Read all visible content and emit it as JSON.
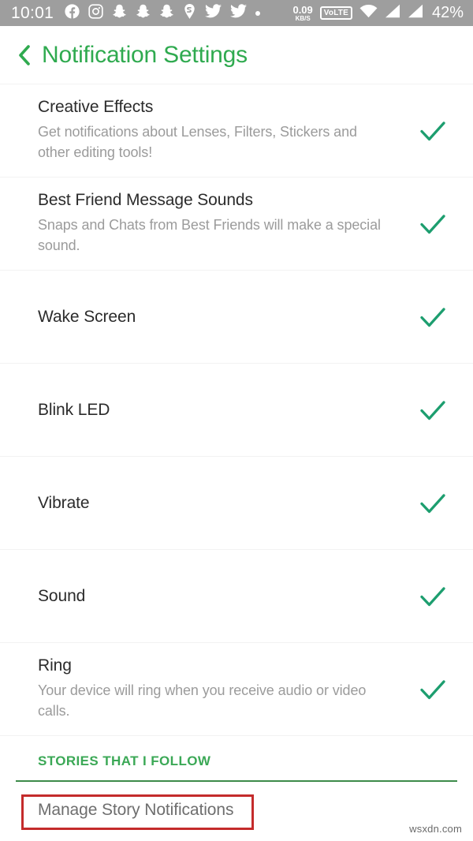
{
  "statusbar": {
    "time": "10:01",
    "app_icons": [
      "facebook-icon",
      "instagram-icon",
      "snapchat-ghost-icon",
      "snapchat-ghost-icon",
      "snapchat-ghost-icon",
      "snapchat-pin-icon",
      "twitter-icon",
      "twitter-icon",
      "more-dot-icon"
    ],
    "data_rate_value": "0.09",
    "data_rate_unit": "KB/S",
    "volte_label": "VoLTE",
    "right_icons": [
      "wifi-icon",
      "signal-sim1-icon",
      "signal-sim2-icon"
    ],
    "battery": "42%"
  },
  "header": {
    "back_label": "‹",
    "title": "Notification Settings",
    "accent": "#2faa4f"
  },
  "settings": {
    "rows": [
      {
        "title": "Creative Effects",
        "subtitle": "Get notifications about Lenses, Filters, Stickers and other editing tools!",
        "checked": true
      },
      {
        "title": "Best Friend Message Sounds",
        "subtitle": "Snaps and Chats from Best Friends will make a special sound.",
        "checked": true
      },
      {
        "title": "Wake Screen",
        "subtitle": "",
        "checked": true
      },
      {
        "title": "Blink LED",
        "subtitle": "",
        "checked": true
      },
      {
        "title": "Vibrate",
        "subtitle": "",
        "checked": true
      },
      {
        "title": "Sound",
        "subtitle": "",
        "checked": true
      },
      {
        "title": "Ring",
        "subtitle": "Your device will ring when you receive audio or video calls.",
        "checked": true
      }
    ],
    "check_color": "#1d9e6f"
  },
  "stories_section": {
    "label": "STORIES THAT I FOLLOW",
    "label_color": "#3ba856",
    "rule_color": "#3d8b4a",
    "manage_link": "Manage Story Notifications",
    "highlight_color": "#c42b2b"
  },
  "watermark": "wsxdn.com"
}
